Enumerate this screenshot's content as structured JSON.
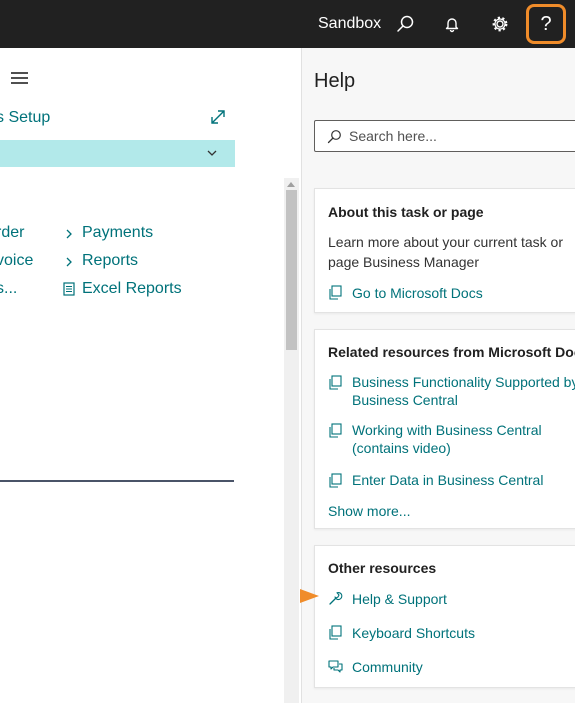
{
  "topbar": {
    "environment": "Sandbox",
    "help_glyph": "?",
    "icons": [
      "search-icon",
      "bell-icon",
      "gear-icon",
      "help-icon"
    ],
    "highlight_color": "#f08c2a"
  },
  "left": {
    "setup_title": "s Setup",
    "links_col1": [
      "rder",
      "voice",
      "s..."
    ],
    "links_col2": [
      "Payments",
      "Reports",
      "Excel Reports"
    ],
    "accent_color": "#00727a",
    "band_color": "#b2e9ea"
  },
  "help": {
    "title": "Help",
    "search_placeholder": "Search here...",
    "about": {
      "title": "About this task or page",
      "text": "Learn more about your current task or page Business Manager",
      "link": "Go to Microsoft Docs"
    },
    "related": {
      "title": "Related resources from Microsoft Docs",
      "links": [
        "Business Functionality Supported by Business Central",
        "Working with Business Central (contains video)",
        "Enter Data in Business Central"
      ],
      "show_more": "Show more..."
    },
    "other": {
      "title": "Other resources",
      "links": [
        "Help & Support",
        "Keyboard Shortcuts",
        "Community"
      ]
    }
  }
}
